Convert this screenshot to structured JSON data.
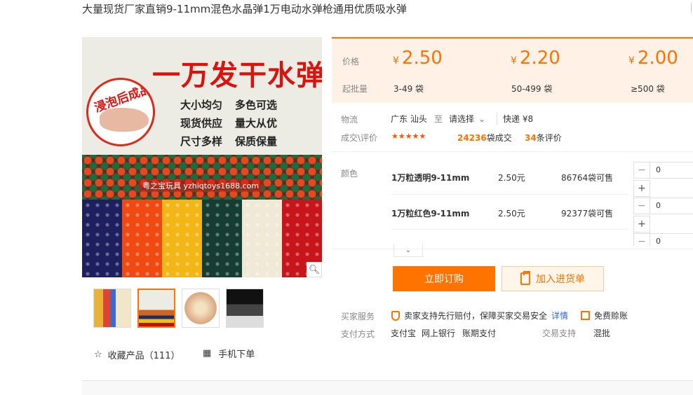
{
  "title": "大量现货厂家直销9-11mm混色水晶弹1万电动水弹枪通用优质吸水弹",
  "image": {
    "headline": "一万发干水弹",
    "badge": "浸泡后成品",
    "features": [
      [
        "大小均匀",
        "多色可选"
      ],
      [
        "现货供应",
        "量大从优"
      ],
      [
        "尺寸多样",
        "保质保量"
      ]
    ],
    "watermark": "粤之宝玩具 yzhiqtoys1688.com"
  },
  "favorites": {
    "label": "收藏产品（111）"
  },
  "mobile_order": {
    "label": "手机下单"
  },
  "pricing": {
    "price_label": "价格",
    "qty_label": "起批量",
    "currency": "¥",
    "tiers": [
      {
        "price": "2.50",
        "qty": "3-49 袋"
      },
      {
        "price": "2.20",
        "qty": "50-499 袋"
      },
      {
        "price": "2.00",
        "qty": "≥500 袋"
      }
    ]
  },
  "logistics": {
    "label": "物流",
    "origin": "广东 汕头",
    "to": "至",
    "destination": "请选择",
    "express": "快递 ¥8"
  },
  "deals": {
    "label": "成交\\评价",
    "stars": "★★★★★",
    "count": "24236",
    "count_suffix": "袋成交",
    "reviews": "34",
    "reviews_suffix": "条评价"
  },
  "color_label": "颜色",
  "variants": [
    {
      "name": "1万粒透明9-11mm",
      "price": "2.50元",
      "stock": "86764袋可售",
      "qty": "0"
    },
    {
      "name": "1万粒红色9-11mm",
      "price": "2.50元",
      "stock": "92377袋可售",
      "qty": "0"
    },
    {
      "qty": "0"
    }
  ],
  "buttons": {
    "order": "立即订购",
    "cart": "加入进货单"
  },
  "services": {
    "label": "买家服务",
    "guarantee": "卖家支持先行赔付，保障买家交易安全",
    "details": "详情",
    "free": "免费赊账"
  },
  "payment": {
    "label": "支付方式",
    "methods": [
      "支付宝",
      "网上银行",
      "账期支付"
    ],
    "trade_label": "交易支持",
    "trade_value": "混批"
  },
  "colors": {
    "accent": "#ff7300",
    "price_bg": "#fff1e6",
    "link": "#3366cc",
    "swatches": [
      "#1d1f5e",
      "#f04a12",
      "#f2b716",
      "#163d33",
      "#efe9d6",
      "#c7161b"
    ]
  }
}
